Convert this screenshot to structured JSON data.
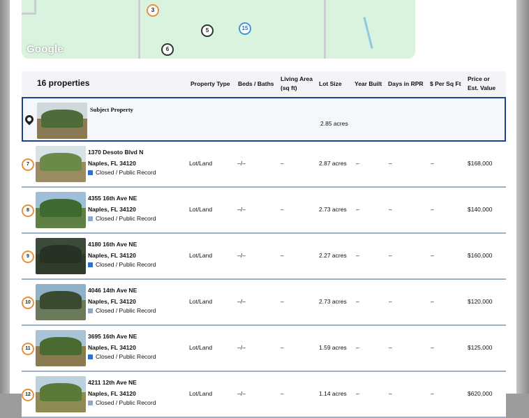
{
  "map": {
    "google_label": "Google",
    "pins": [
      {
        "label": "3",
        "style": "orange"
      },
      {
        "label": "5",
        "style": "dark"
      },
      {
        "label": "15",
        "style": "blue"
      },
      {
        "label": "6",
        "style": "dark"
      }
    ]
  },
  "table": {
    "count_label": "16 properties",
    "headers": {
      "property_type": "Property Type",
      "beds_baths": "Beds / Baths",
      "living_area_1": "Living Area",
      "living_area_2": "(sq ft)",
      "lot_size": "Lot Size",
      "year_built": "Year Built",
      "days_in_rpr": "Days in RPR",
      "per_sq_ft": "$ Per Sq Ft",
      "price_1": "Price or",
      "price_2": "Est. Value"
    },
    "subject": {
      "title": "Subject Property",
      "lot_size": "2.85 acres"
    },
    "rows": [
      {
        "num": "7",
        "street": "1370 Desoto Blvd N",
        "city": "Naples, FL 34120",
        "status": "Closed / Public Record",
        "type": "Lot/Land",
        "beds": "–/–",
        "living": "–",
        "lot": "2.87 acres",
        "year": "–",
        "days": "–",
        "ppsf": "–",
        "price": "$168,000"
      },
      {
        "num": "8",
        "street": "4355 16th Ave NE",
        "city": "Naples, FL 34120",
        "status": "Closed / Public Record",
        "type": "Lot/Land",
        "beds": "–/–",
        "living": "–",
        "lot": "2.73 acres",
        "year": "–",
        "days": "–",
        "ppsf": "–",
        "price": "$140,000"
      },
      {
        "num": "9",
        "street": "4180 16th Ave NE",
        "city": "Naples, FL 34120",
        "status": "Closed / Public Record",
        "type": "Lot/Land",
        "beds": "–/–",
        "living": "–",
        "lot": "2.27 acres",
        "year": "–",
        "days": "–",
        "ppsf": "–",
        "price": "$160,000"
      },
      {
        "num": "10",
        "street": "4046 14th Ave NE",
        "city": "Naples, FL 34120",
        "status": "Closed / Public Record",
        "type": "Lot/Land",
        "beds": "–/–",
        "living": "–",
        "lot": "2.73 acres",
        "year": "–",
        "days": "–",
        "ppsf": "–",
        "price": "$120,000"
      },
      {
        "num": "11",
        "street": "3695 16th Ave NE",
        "city": "Naples, FL 34120",
        "status": "Closed / Public Record",
        "type": "Lot/Land",
        "beds": "–/–",
        "living": "–",
        "lot": "1.59 acres",
        "year": "–",
        "days": "–",
        "ppsf": "–",
        "price": "$125,000"
      },
      {
        "num": "12",
        "street": "4211 12th Ave NE",
        "city": "Naples, FL 34120",
        "status": "Closed / Public Record",
        "type": "Lot/Land",
        "beds": "–/–",
        "living": "–",
        "lot": "1.14 acres",
        "year": "–",
        "days": "–",
        "ppsf": "–",
        "price": "$620,000"
      }
    ]
  }
}
